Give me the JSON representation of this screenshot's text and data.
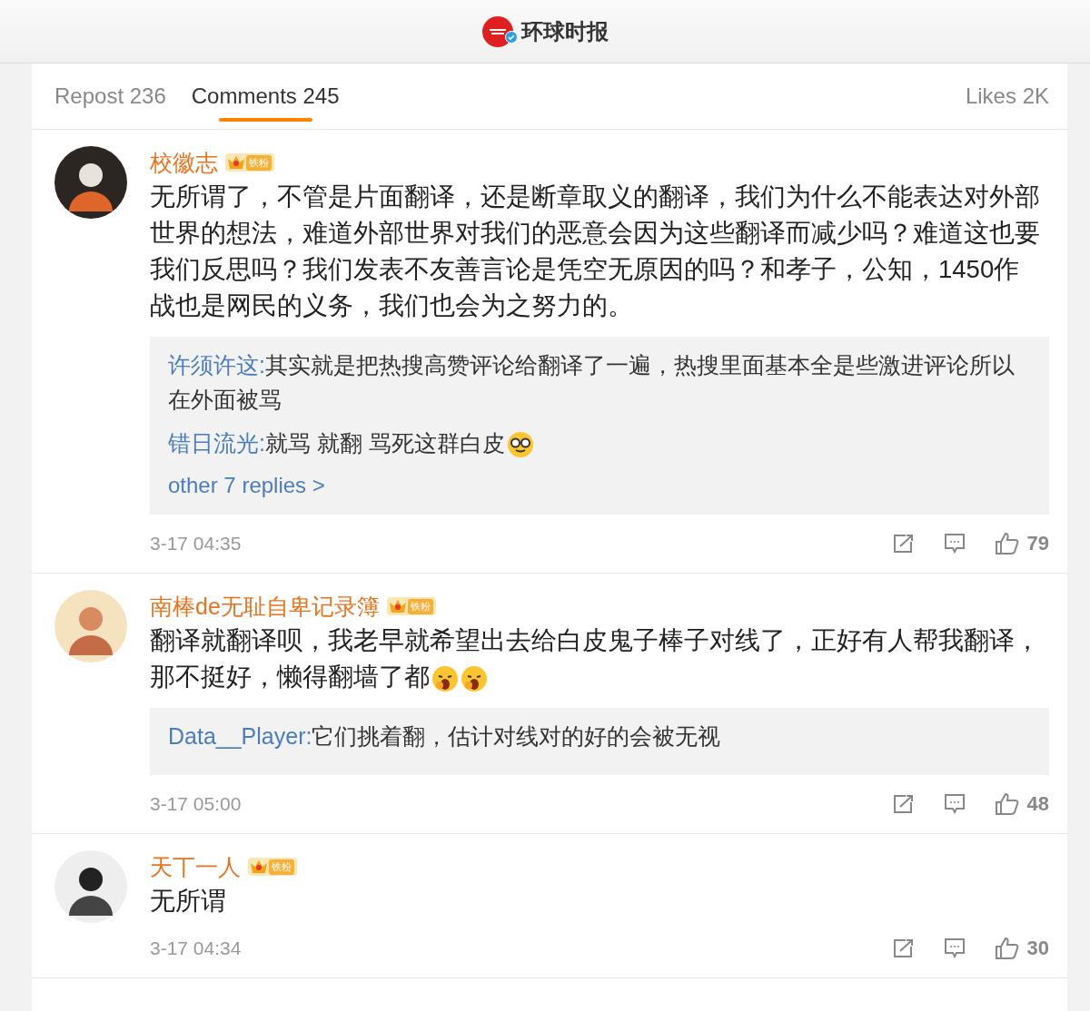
{
  "header": {
    "title": "环球时报",
    "verified": true
  },
  "tabs": [
    {
      "label": "Repost 236",
      "selected": false
    },
    {
      "label": "Comments 245",
      "selected": true
    },
    {
      "label": "Likes 2K",
      "selected": false
    }
  ],
  "comments": [
    {
      "user": "校徽志",
      "badge": "铁粉",
      "text": "无所谓了，不管是片面翻译，还是断章取义的翻译，我们为什么不能表达对外部世界的想法，难道外部世界对我们的恶意会因为这些翻译而减少吗？难道这也要我们反思吗？我们发表不友善言论是凭空无原因的吗？和孝子，公知，1450作战也是网民的义务，我们也会为之努力的。",
      "replies": [
        {
          "user": "许须许这:",
          "text": "其实就是把热搜高赞评论给翻译了一遍，热搜里面基本全是些激进评论所以在外面被骂"
        },
        {
          "user": "错日流光:",
          "text": "就骂 就翻 骂死这群白皮",
          "emojis": [
            {
              "kind": "nerd"
            }
          ]
        }
      ],
      "more": "other 7 replies >",
      "time": "3-17 04:35",
      "likes": "79"
    },
    {
      "user": "南棒de无耻自卑记录簿",
      "badge": "铁粉",
      "text": "翻译就翻译呗，我老早就希望出去给白皮鬼子棒子对线了，正好有人帮我翻译，那不挺好，懒得翻墙了都",
      "emojis": [
        {
          "kind": "yawn"
        },
        {
          "kind": "yawn"
        }
      ],
      "replies": [
        {
          "user": "Data__Player:",
          "text": "它们挑着翻，估计对线对的好的会被无视"
        }
      ],
      "time": "3-17 05:00",
      "likes": "48"
    },
    {
      "user": "天丅一人",
      "badge": "铁粉",
      "text": "无所谓",
      "time": "3-17 04:34",
      "likes": "30"
    }
  ]
}
